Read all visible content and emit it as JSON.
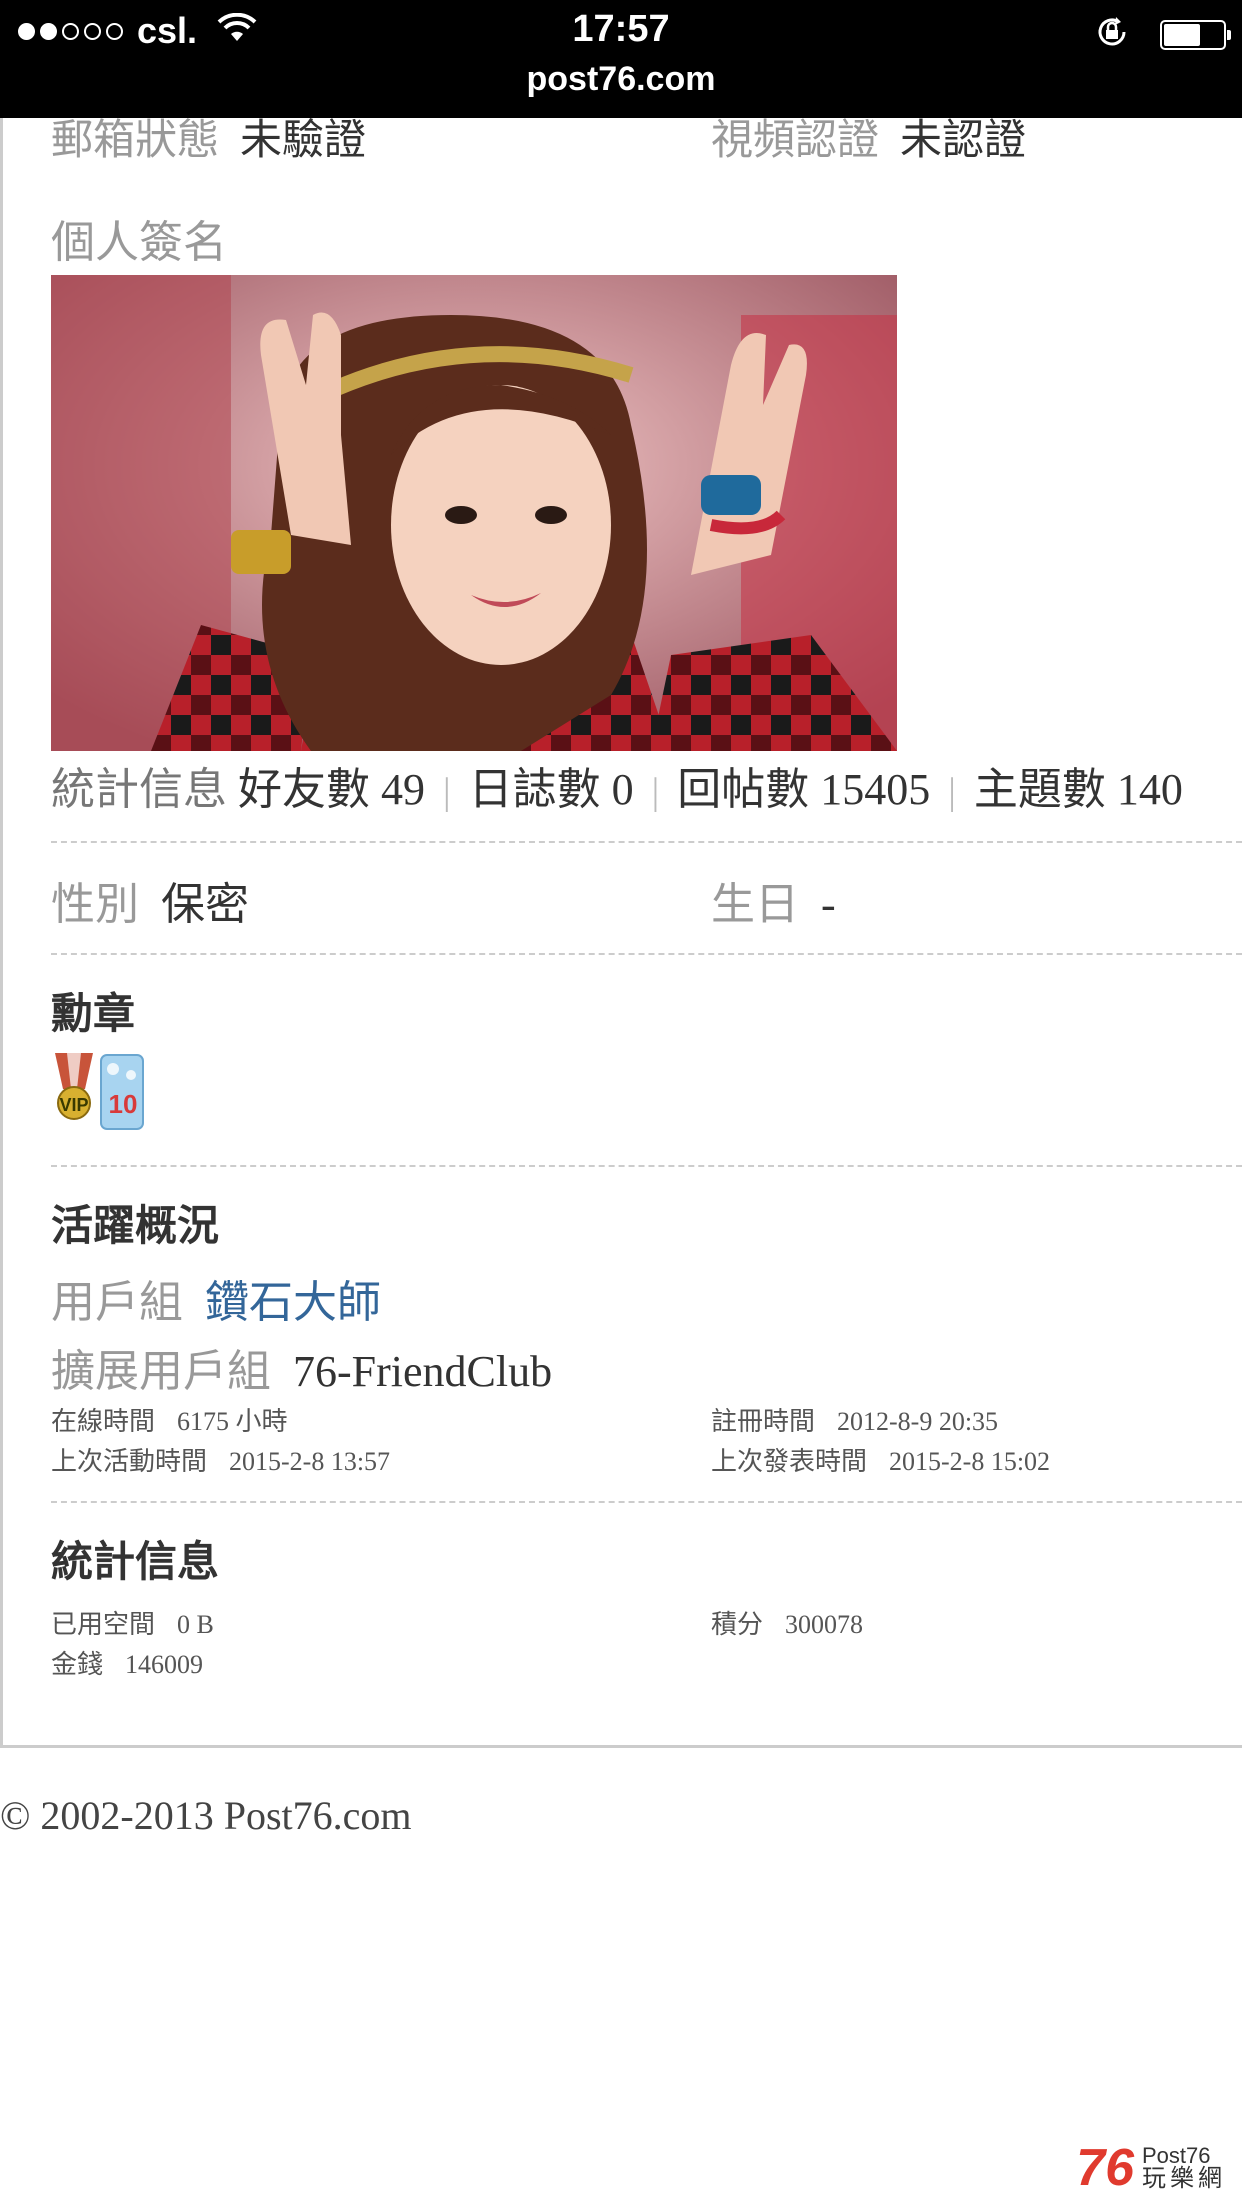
{
  "status_bar": {
    "carrier": "csl.",
    "time": "17:57",
    "url": "post76.com"
  },
  "profile": {
    "email_label": "郵箱狀態",
    "email_value": "未驗證",
    "video_label": "視頻認證",
    "video_value": "未認證",
    "signature_label": "個人簽名",
    "stats": {
      "label": "統計信息",
      "friends_label": "好友數",
      "friends": "49",
      "blogs_label": "日誌數",
      "blogs": "0",
      "replies_label": "回帖數",
      "replies": "15405",
      "topics_label": "主題數",
      "topics": "140"
    },
    "gender_label": "性別",
    "gender_value": "保密",
    "birthday_label": "生日",
    "birthday_value": "-",
    "medals_title": "勳章",
    "activity_title": "活躍概況",
    "usergroup_label": "用戶組",
    "usergroup_value": "鑽石大師",
    "ext_usergroup_label": "擴展用戶組",
    "ext_usergroup_value": "76-FriendClub",
    "online_label": "在線時間",
    "online_value": "6175 小時",
    "register_label": "註冊時間",
    "register_value": "2012-8-9 20:35",
    "last_active_label": "上次活動時間",
    "last_active_value": "2015-2-8 13:57",
    "last_post_label": "上次發表時間",
    "last_post_value": "2015-2-8 15:02",
    "stat_title": "統計信息",
    "space_label": "已用空間",
    "space_value": "0 B",
    "points_label": "積分",
    "points_value": "300078",
    "money_label": "金錢",
    "money_value": "146009"
  },
  "footer": {
    "copyright": "© 2002-2013 Post76.com"
  },
  "logo": {
    "number": "76",
    "name": "Post76",
    "subtitle": "玩樂網"
  }
}
